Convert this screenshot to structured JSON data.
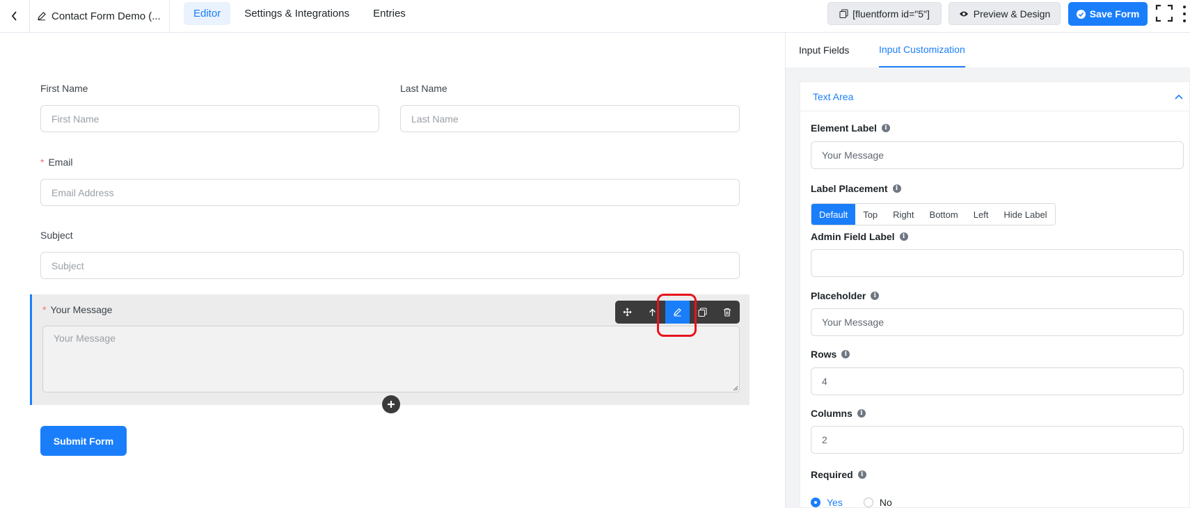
{
  "topbar": {
    "form_title": "Contact Form Demo (...",
    "tabs": [
      {
        "label": "Editor",
        "active": true
      },
      {
        "label": "Settings & Integrations",
        "active": false
      },
      {
        "label": "Entries",
        "active": false
      }
    ],
    "shortcode_label": "[fluentform id=\"5\"]",
    "preview_label": "Preview & Design",
    "save_label": "Save Form",
    "icons": {
      "back": "chevron-left-icon",
      "title": "pencil-icon",
      "shortcode": "copy-icon",
      "preview": "eye-icon",
      "save": "check-circle-icon",
      "fullscreen": "fullscreen-icon",
      "more": "kebab-icon"
    }
  },
  "form": {
    "first_name": {
      "label": "First Name",
      "placeholder": "First Name"
    },
    "last_name": {
      "label": "Last Name",
      "placeholder": "Last Name"
    },
    "email": {
      "label": "Email",
      "placeholder": "Email Address",
      "required": true
    },
    "subject": {
      "label": "Subject",
      "placeholder": "Subject"
    },
    "message": {
      "label": "Your Message",
      "placeholder": "Your Message",
      "required": true
    },
    "submit_label": "Submit Form",
    "toolbar_icons": [
      "move-icon",
      "arrow-up-icon",
      "edit-icon",
      "duplicate-icon",
      "trash-icon"
    ]
  },
  "panel": {
    "tabs": [
      {
        "label": "Input Fields",
        "active": false
      },
      {
        "label": "Input Customization",
        "active": true
      }
    ],
    "section_title": "Text Area",
    "element_label": {
      "label": "Element Label",
      "value": "Your Message"
    },
    "label_placement": {
      "label": "Label Placement",
      "options": [
        "Default",
        "Top",
        "Right",
        "Bottom",
        "Left",
        "Hide Label"
      ],
      "selected": "Default"
    },
    "admin_field_label": {
      "label": "Admin Field Label",
      "value": ""
    },
    "placeholder": {
      "label": "Placeholder",
      "value": "Your Message"
    },
    "rows": {
      "label": "Rows",
      "value": "4"
    },
    "columns": {
      "label": "Columns",
      "value": "2"
    },
    "required": {
      "label": "Required",
      "yes": "Yes",
      "no": "No",
      "selected": "Yes"
    }
  },
  "colors": {
    "accent": "#1a7efb",
    "required": "#f56c6c",
    "highlight": "#e8131c",
    "toolbar": "#3b3b3b"
  }
}
